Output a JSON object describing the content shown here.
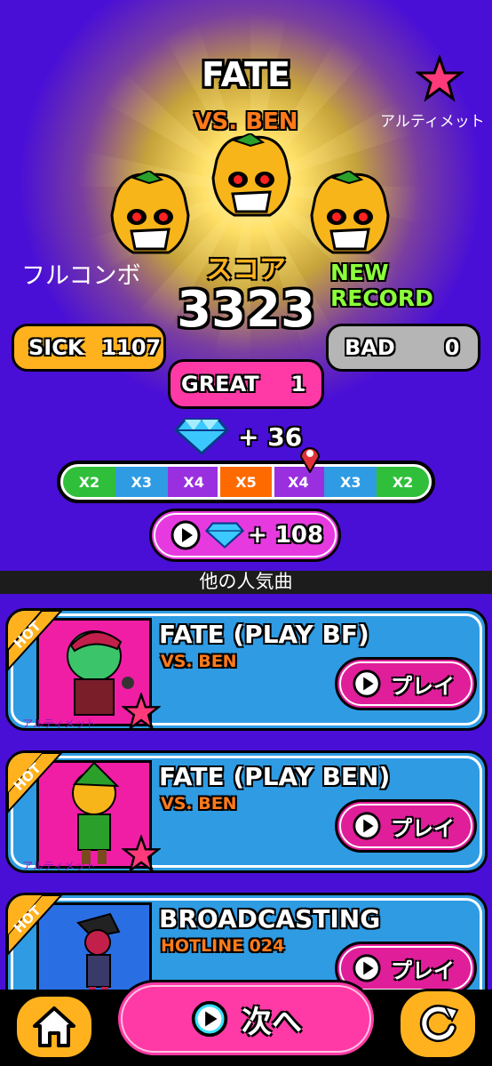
{
  "result": {
    "song_title": "FATE",
    "artist": "VS. BEN",
    "ultimate_label": "アルティメット",
    "full_combo_label": "フルコンボ",
    "score_label": "スコア",
    "new_record_label": "NEW RECORD",
    "score": "3323",
    "sick": {
      "label": "SICK",
      "value": "1107"
    },
    "bad": {
      "label": "BAD",
      "value": "0"
    },
    "great": {
      "label": "GREAT",
      "value": "1"
    },
    "gems": "+ 36",
    "multipliers": [
      "X2",
      "X3",
      "X4",
      "X5",
      "X4",
      "X3",
      "X2"
    ],
    "active_multiplier": "X5",
    "ad_reward": "+ 108"
  },
  "other_songs": {
    "header": "他の人気曲",
    "items": [
      {
        "hot": "HOT",
        "title": "FATE (PLAY BF)",
        "artist": "VS. BEN",
        "play_label": "プレイ",
        "tag": "アルティメット"
      },
      {
        "hot": "HOT",
        "title": "FATE (PLAY BEN)",
        "artist": "VS. BEN",
        "play_label": "プレイ",
        "tag": "アルティメット"
      },
      {
        "hot": "HOT",
        "title": "BROADCASTING",
        "artist": "HOTLINE 024",
        "play_label": "プレイ",
        "tag": ""
      }
    ]
  },
  "bottom": {
    "next_label": "次へ"
  },
  "colors": {
    "background": "#4a0fd6",
    "sick": "#ffb21e",
    "great": "#ff3aa6",
    "bad": "#b5b5b5",
    "new_record": "#8cff3a",
    "card": "#2f9be3"
  }
}
